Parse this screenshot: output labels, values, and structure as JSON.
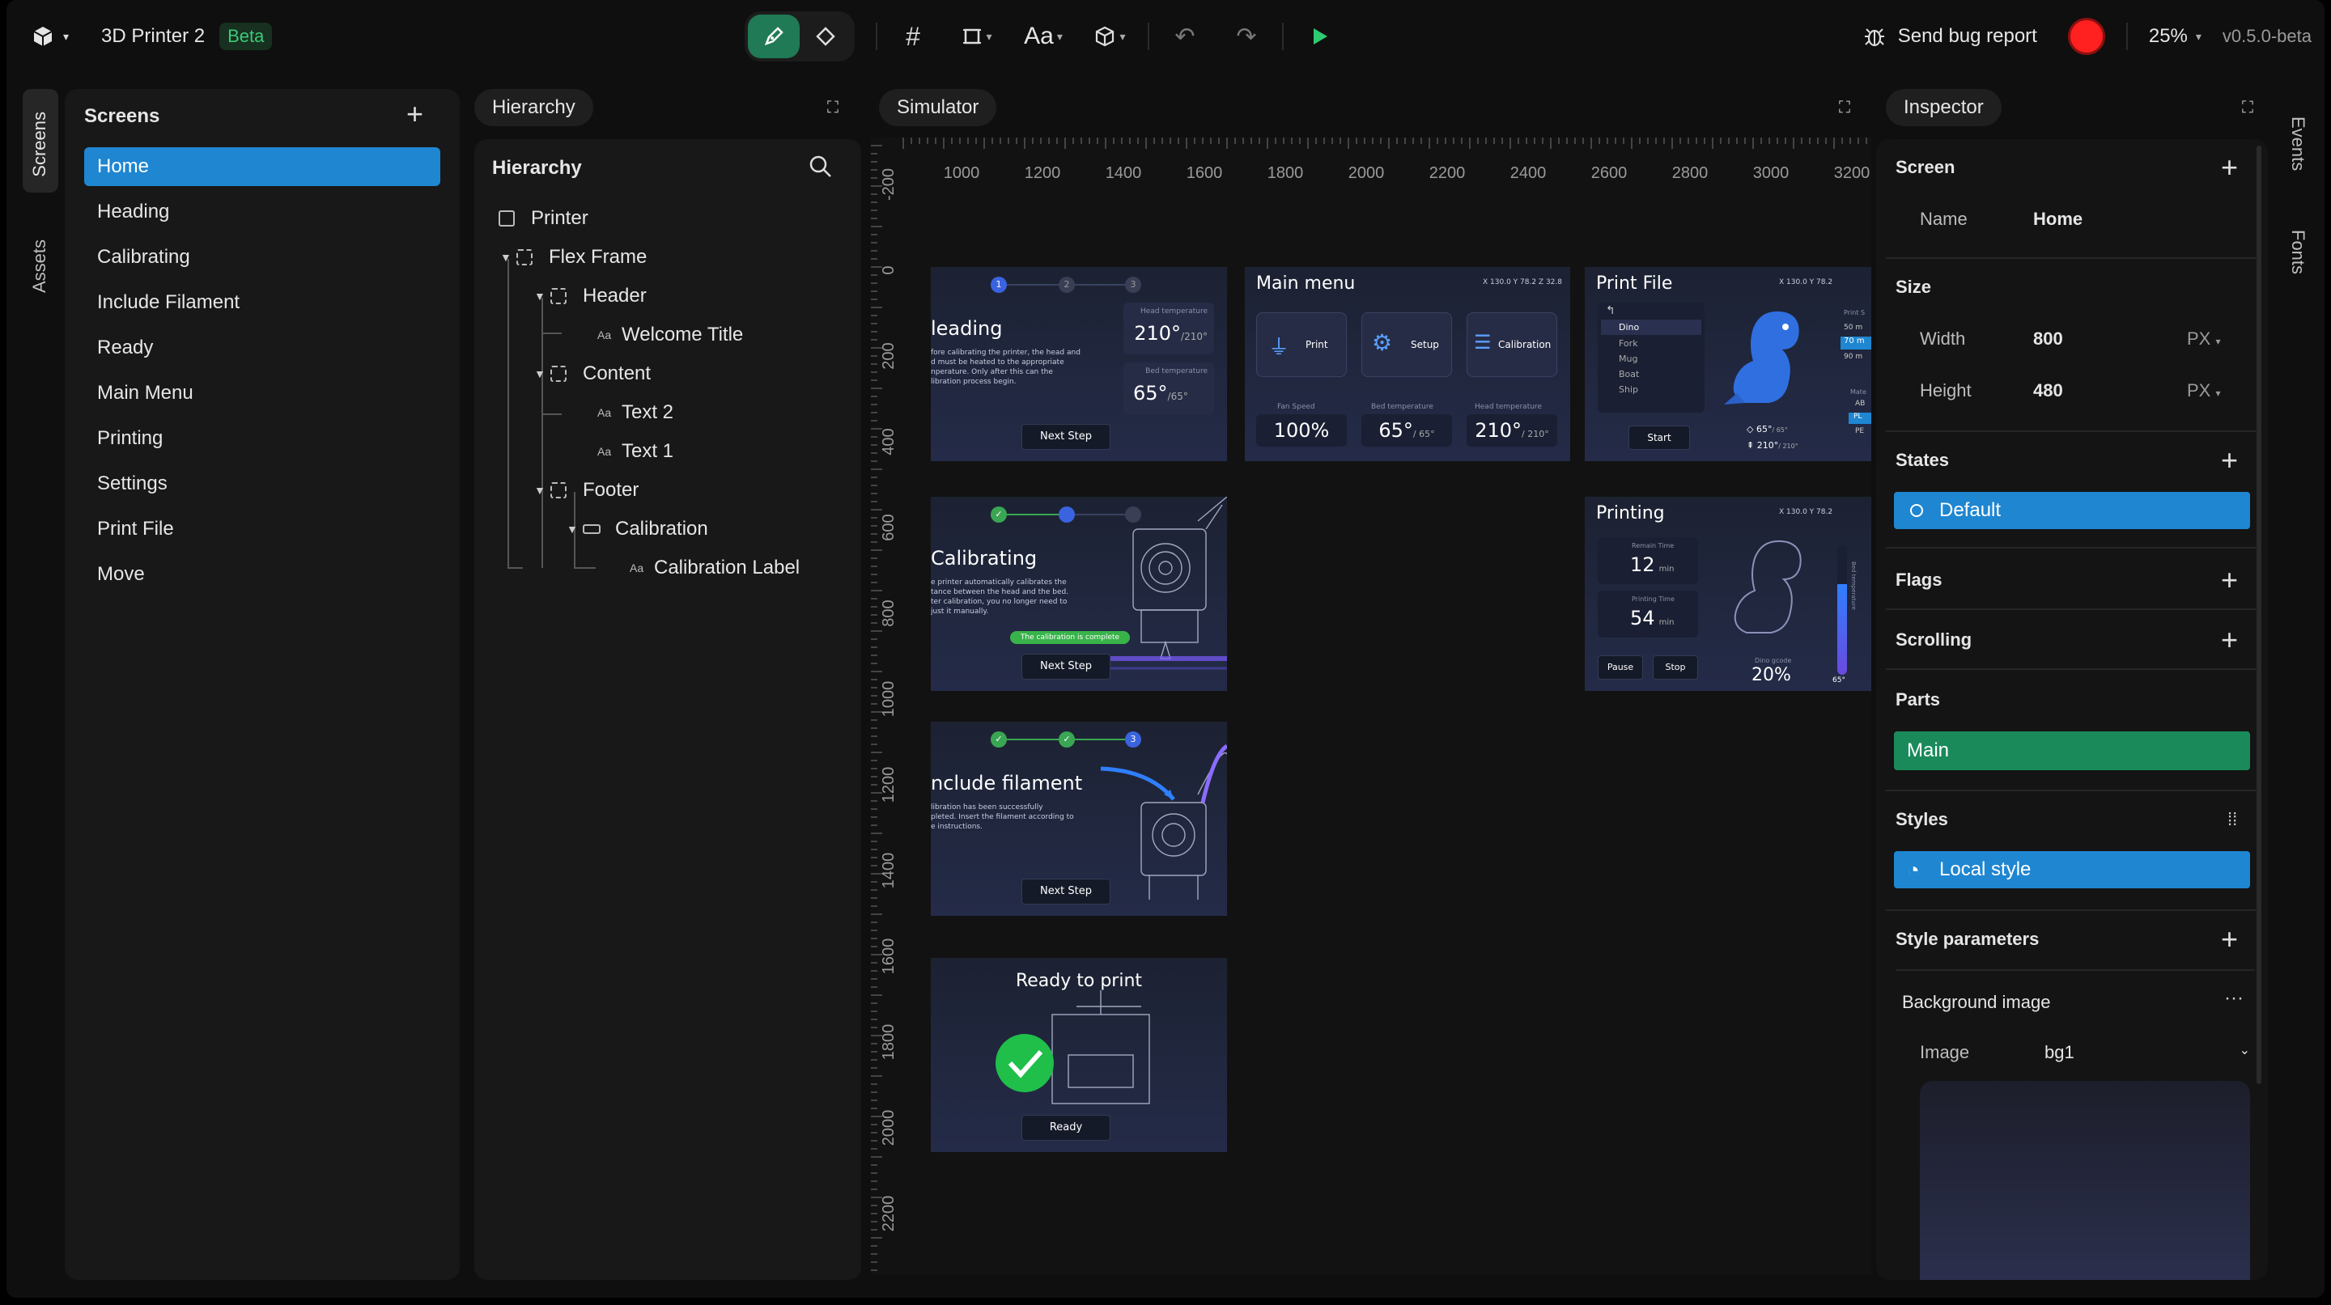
{
  "app": {
    "project_name": "3D Printer 2",
    "beta_label": "Beta"
  },
  "topbar": {
    "bug_report": "Send bug report",
    "zoom": "25%",
    "version": "v0.5.0-beta"
  },
  "sidebar_tabs": {
    "screens": "Screens",
    "assets": "Assets"
  },
  "screens_panel": {
    "title": "Screens",
    "items": [
      "Home",
      "Heading",
      "Calibrating",
      "Include Filament",
      "Ready",
      "Main Menu",
      "Printing",
      "Settings",
      "Print File",
      "Move"
    ]
  },
  "hierarchy_panel": {
    "pill": "Hierarchy",
    "title": "Hierarchy",
    "nodes": [
      "Printer",
      "Flex Frame",
      "Header",
      "Welcome Title",
      "Content",
      "Text 2",
      "Text 1",
      "Footer",
      "Calibration",
      "Calibration Label"
    ]
  },
  "simulator_panel": {
    "pill": "Simulator",
    "ruler_x": [
      "1000",
      "1200",
      "1400",
      "1600",
      "1800",
      "2000",
      "2200",
      "2400",
      "2600",
      "2800",
      "3000",
      "3200"
    ],
    "ruler_y": [
      "-200",
      "0",
      "200",
      "400",
      "600",
      "800",
      "1000",
      "1200",
      "1400",
      "1600",
      "1800",
      "2000",
      "2200",
      "2400"
    ],
    "cards": {
      "heading": {
        "title": "leading",
        "body": "fore calibrating the printer, the head and\nd must be heated to the appropriate\nnperature. Only after this can the\nlibration process begin.",
        "head_temp_label": "Head temperature",
        "head_temp": "210°",
        "head_temp_target": "/210°",
        "bed_temp_label": "Bed temperature",
        "bed_temp": "65°",
        "bed_temp_target": "/65°",
        "button": "Next Step",
        "steps": [
          "1",
          "2",
          "3"
        ]
      },
      "calibrating": {
        "title": "Calibrating",
        "body": "e printer automatically calibrates the\ntance between the head and the bed.\nter calibration, you no longer need to\njust it manually.",
        "status": "The calibration is complete",
        "button": "Next Step",
        "step3": "3"
      },
      "include": {
        "title": "nclude filament",
        "body": "libration has been successfully\npleted. Insert the filament according to\ne instructions.",
        "button": "Next Step",
        "step3": "3"
      },
      "ready": {
        "title": "Ready to print",
        "button": "Ready"
      },
      "main_menu": {
        "title": "Main menu",
        "coords": "X 130.0  Y 78.2  Z 32.8",
        "tiles": [
          "Print",
          "Setup",
          "Calibration"
        ],
        "fan_label": "Fan Speed",
        "fan": "100%",
        "bed_label": "Bed temperature",
        "bed": "65°",
        "bed_target": "/ 65°",
        "head_label": "Head temperature",
        "head": "210°",
        "head_target": "/ 210°"
      },
      "print_file": {
        "title": "Print File",
        "coords": "X 130.0  Y 78.2",
        "files": [
          "Dino",
          "Fork",
          "Mug",
          "Boat",
          "Ship"
        ],
        "button": "Start",
        "temp1": "65°",
        "temp1_t": "/ 65°",
        "temp2": "210°",
        "temp2_t": "/ 210°",
        "side_label": "Print S",
        "side_vals": [
          "50 m",
          "70 m",
          "90 m"
        ],
        "mat_label": "Mate",
        "mats": [
          "AB",
          "PL",
          "PE"
        ]
      },
      "printing": {
        "title": "Printing",
        "coords": "X 130.0  Y 78.2",
        "remain_label": "Remain Time",
        "remain": "12",
        "remain_unit": "min",
        "printing_label": "Printing Time",
        "printing": "54",
        "printing_unit": "min",
        "pause": "Pause",
        "stop": "Stop",
        "gcode_label": "Dino gcode",
        "gcode": "20%",
        "bed_temp_label": "Bed temperature",
        "bed_temp_value": "65°"
      }
    }
  },
  "inspector": {
    "pill": "Inspector",
    "screen_title": "Screen",
    "name_label": "Name",
    "name_value": "Home",
    "size_title": "Size",
    "width_label": "Width",
    "width_value": "800",
    "width_unit": "PX",
    "height_label": "Height",
    "height_value": "480",
    "height_unit": "PX",
    "states_title": "States",
    "state_default": "Default",
    "flags_title": "Flags",
    "scrolling_title": "Scrolling",
    "parts_title": "Parts",
    "part_main": "Main",
    "styles_title": "Styles",
    "style_local": "Local style",
    "style_params_title": "Style parameters",
    "bg_image_label": "Background image",
    "image_label": "Image",
    "image_value": "bg1"
  },
  "right_tabs": {
    "events": "Events",
    "fonts": "Fonts"
  },
  "colors": {
    "accent_blue": "#1f86d1",
    "accent_green": "#1a8a5b",
    "play_green": "#2ecc71",
    "record_red": "#ff2020"
  }
}
